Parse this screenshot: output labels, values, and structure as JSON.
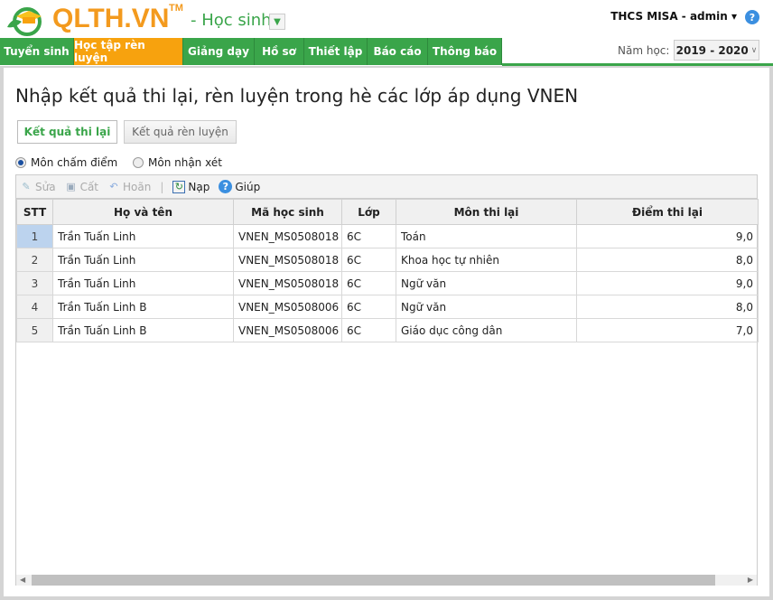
{
  "header": {
    "logo": "QLTH.VN",
    "tm": "TM",
    "role": "- Học sinh",
    "user": "THCS MISA - admin ▾",
    "help": "?"
  },
  "nav": [
    "Tuyển sinh",
    "Học tập rèn luyện",
    "Giảng dạy",
    "Hồ sơ",
    "Thiết lập",
    "Báo cáo",
    "Thông báo"
  ],
  "year": {
    "label": "Năm học:",
    "value": "2019 - 2020"
  },
  "page": {
    "title": "Nhập kết quả thi lại, rèn luyện trong hè các lớp áp dụng VNEN",
    "tabs": [
      "Kết quả thi lại",
      "Kết quả rèn luyện"
    ],
    "radios": [
      "Môn chấm điểm",
      "Môn nhận xét"
    ],
    "toolbar": [
      "Sửa",
      "Cất",
      "Hoãn",
      "Nạp",
      "Giúp"
    ]
  },
  "table": {
    "columns": [
      "STT",
      "Họ và tên",
      "Mã học sinh",
      "Lớp",
      "Môn thi lại",
      "Điểm thi lại"
    ],
    "rows": [
      [
        "1",
        "Trần Tuấn Linh",
        "VNEN_MS0508018",
        "6C",
        "Toán",
        "9,0"
      ],
      [
        "2",
        "Trần Tuấn Linh",
        "VNEN_MS0508018",
        "6C",
        "Khoa học tự nhiên",
        "8,0"
      ],
      [
        "3",
        "Trần Tuấn Linh",
        "VNEN_MS0508018",
        "6C",
        "Ngữ văn",
        "9,0"
      ],
      [
        "4",
        "Trần Tuấn Linh B",
        "VNEN_MS0508006",
        "6C",
        "Ngữ văn",
        "8,0"
      ],
      [
        "5",
        "Trần Tuấn Linh B",
        "VNEN_MS0508006",
        "6C",
        "Giáo dục công dân",
        "7,0"
      ]
    ]
  },
  "colors": {
    "green": "#3aa54a",
    "orange": "#f7a20e"
  }
}
